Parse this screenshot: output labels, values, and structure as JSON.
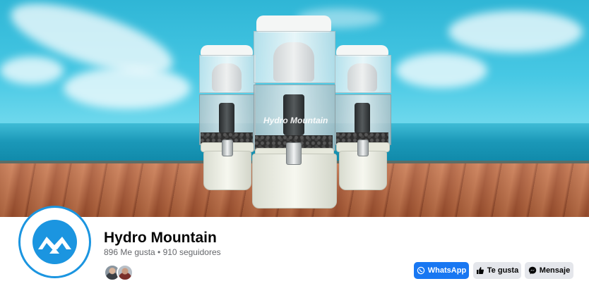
{
  "page": {
    "name": "Hydro Mountain",
    "stats": "896 Me gusta • 910 seguidores"
  },
  "cover": {
    "product_brand": "Hydro Mountain"
  },
  "actions": {
    "whatsapp_label": "WhatsApp",
    "like_label": "Te gusta",
    "message_label": "Mensaje"
  },
  "icons": {
    "whatsapp": "whatsapp-icon",
    "like": "thumbs-up-icon",
    "message": "messenger-icon"
  },
  "colors": {
    "accent": "#1877f2",
    "logo": "#1b95e0",
    "secondary_button": "#e4e6eb",
    "muted_text": "#65676b"
  }
}
